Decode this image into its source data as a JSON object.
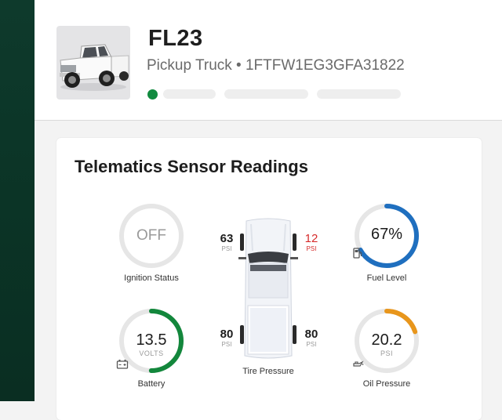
{
  "vehicle": {
    "name": "FL23",
    "type": "Pickup Truck",
    "separator": "•",
    "vin": "1FTFW1EG3GFA31822",
    "status_color": "#118a3f"
  },
  "telematics": {
    "title": "Telematics Sensor Readings",
    "ignition": {
      "value": "OFF",
      "label": "Ignition Status"
    },
    "fuel": {
      "value": "67%",
      "level": 0.67,
      "label": "Fuel Level",
      "icon": "fuel-pump-icon",
      "color": "#1f6fbf"
    },
    "battery": {
      "value": "13.5",
      "unit": "VOLTS",
      "level": 0.5,
      "label": "Battery",
      "icon": "battery-icon",
      "color": "#13873c"
    },
    "oil": {
      "value": "20.2",
      "unit": "PSI",
      "level": 0.2,
      "label": "Oil Pressure",
      "icon": "oil-can-icon",
      "color": "#e8961c"
    },
    "tires": {
      "label": "Tire Pressure",
      "unit": "PSI",
      "front_left": "63",
      "front_right": "12",
      "rear_left": "80",
      "rear_right": "80",
      "alert_color": "#d62b2b"
    }
  }
}
